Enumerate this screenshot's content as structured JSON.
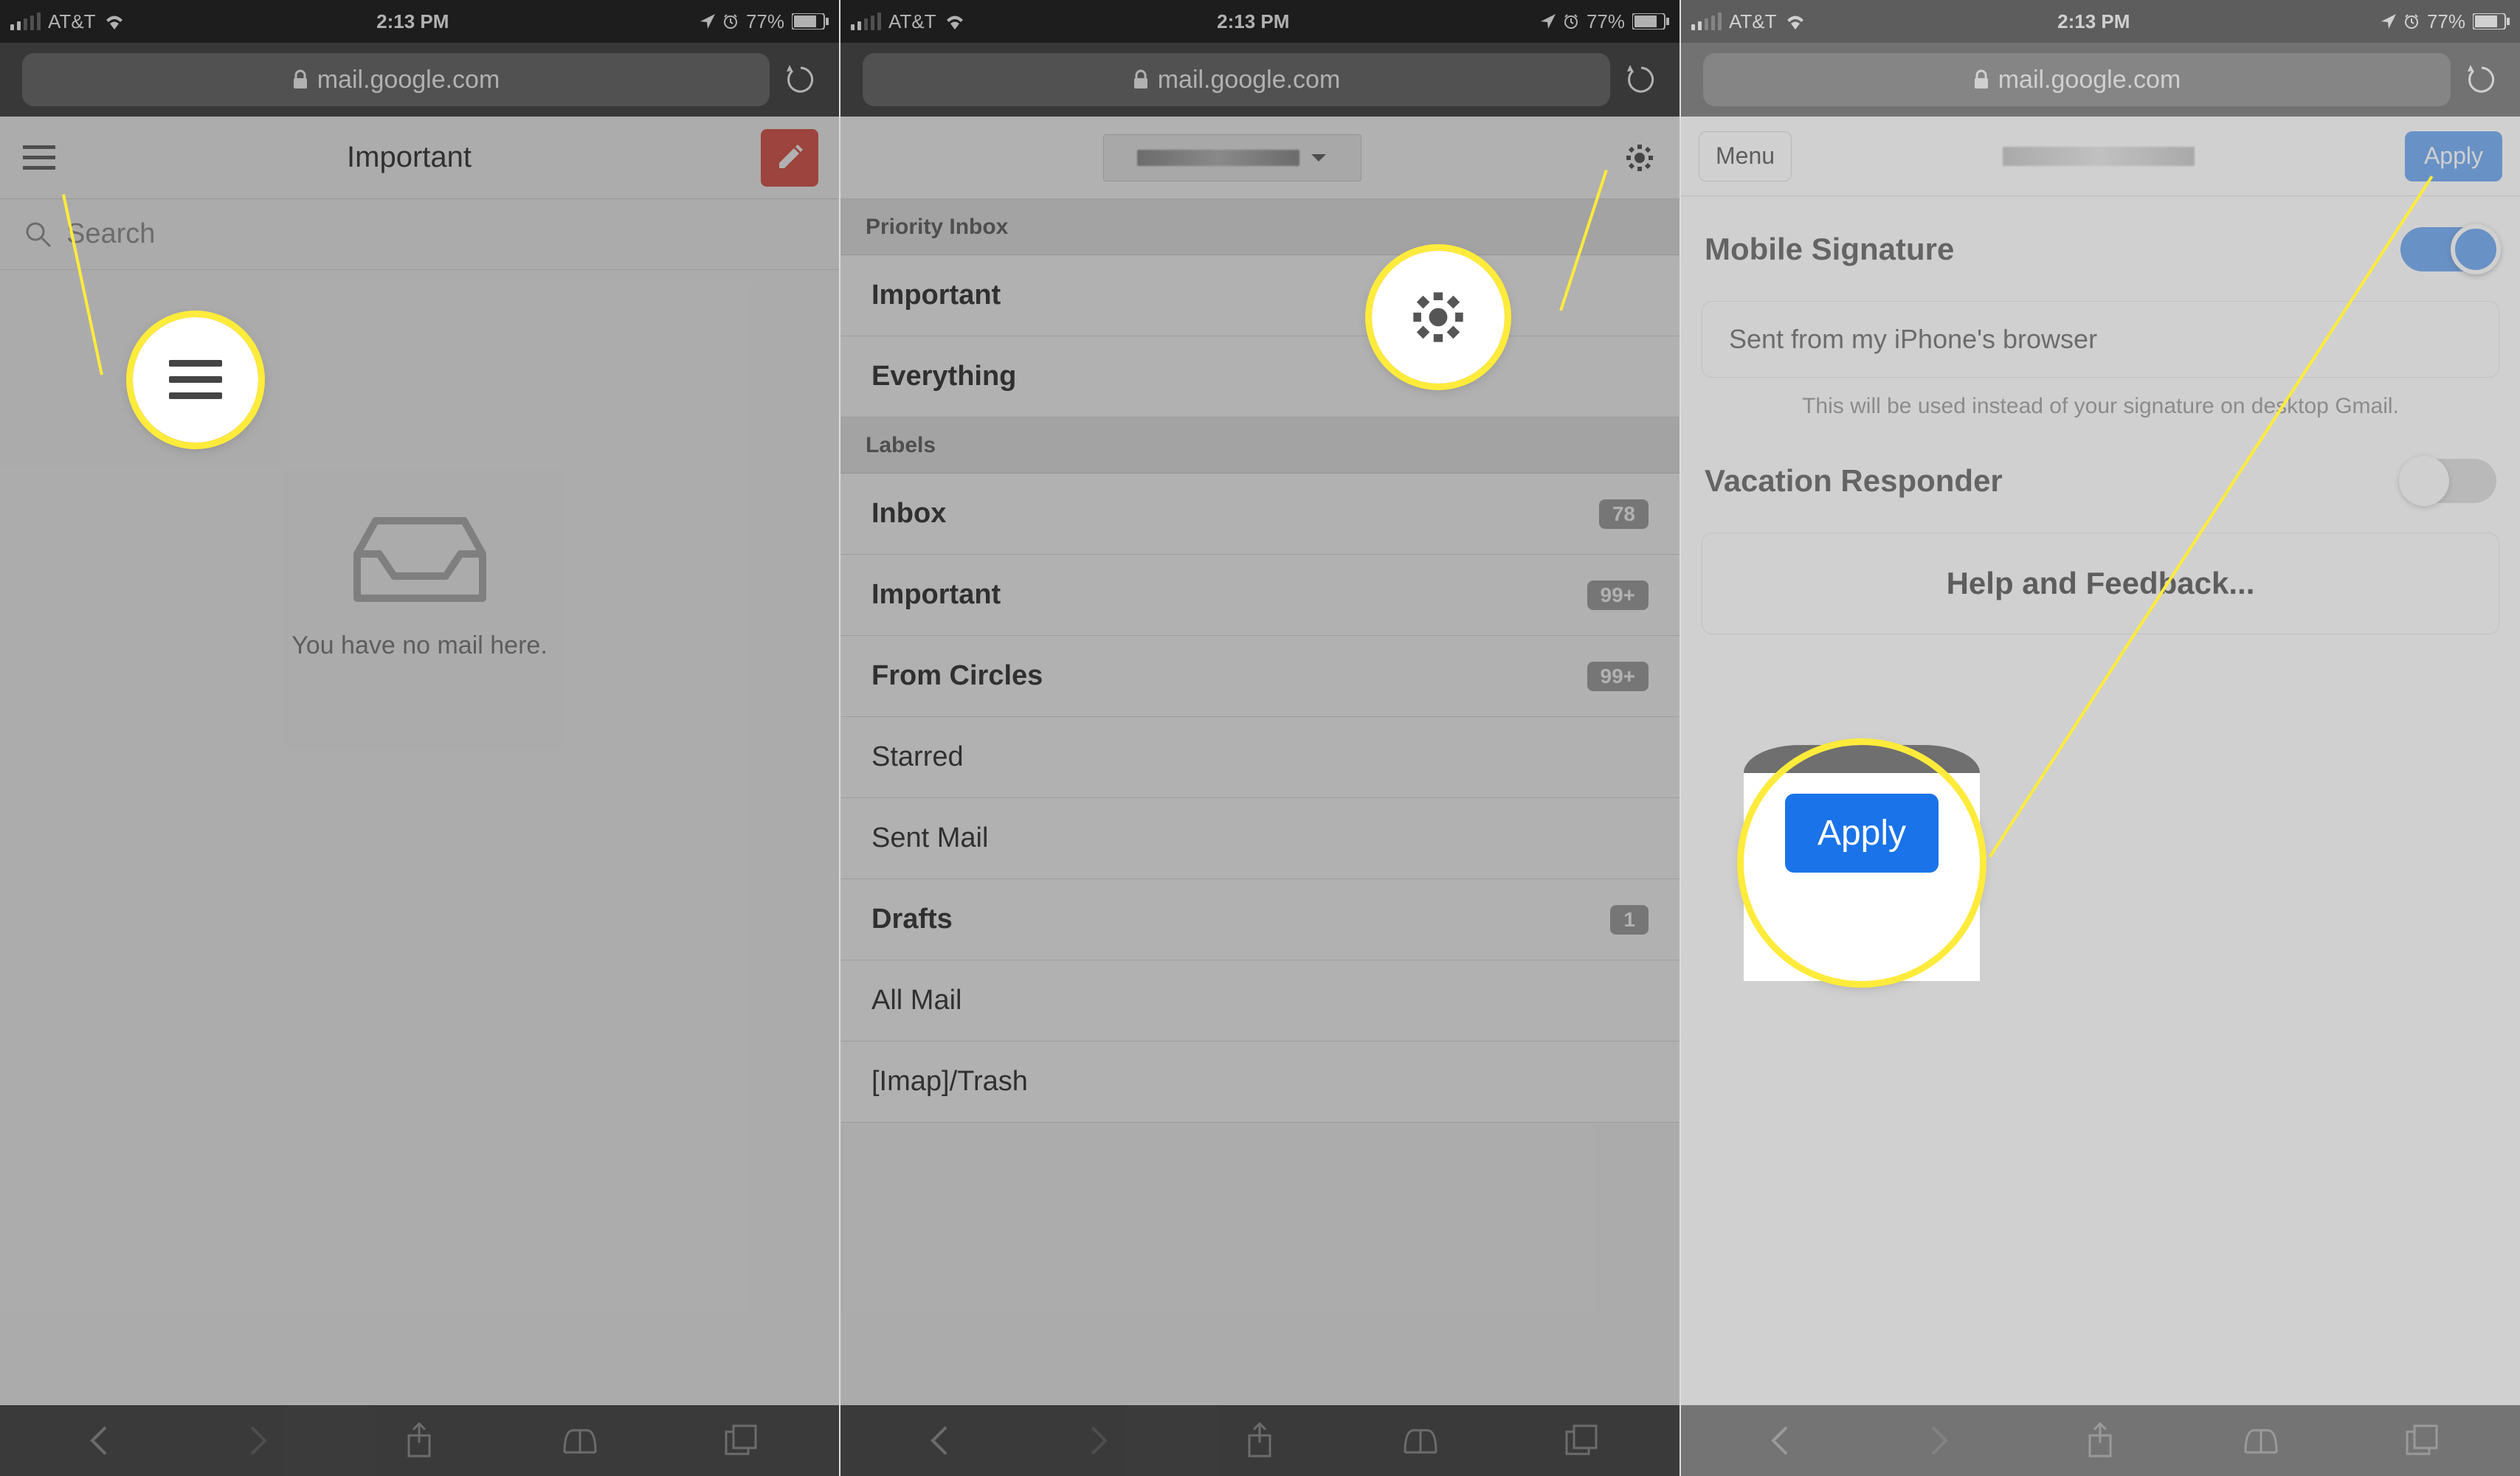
{
  "statusbar": {
    "carrier": "AT&T",
    "time": "2:13 PM",
    "battery": "77%"
  },
  "url": "mail.google.com",
  "screen1": {
    "page_title": "Important",
    "search_placeholder": "Search",
    "empty_message": "You have no mail here."
  },
  "screen2": {
    "sections": {
      "priority": "Priority Inbox",
      "labels": "Labels"
    },
    "priority_items": [
      {
        "label": "Important"
      },
      {
        "label": "Everything"
      }
    ],
    "label_items": [
      {
        "label": "Inbox",
        "badge": "78",
        "bold": true
      },
      {
        "label": "Important",
        "badge": "99+",
        "bold": true
      },
      {
        "label": "From Circles",
        "badge": "99+",
        "bold": true
      },
      {
        "label": "Starred",
        "bold": false
      },
      {
        "label": "Sent Mail",
        "bold": false
      },
      {
        "label": "Drafts",
        "badge": "1",
        "bold": true
      },
      {
        "label": "All Mail",
        "bold": false
      },
      {
        "label": "[Imap]/Trash",
        "bold": false
      }
    ]
  },
  "screen3": {
    "menu_label": "Menu",
    "apply_label": "Apply",
    "mobile_signature_label": "Mobile Signature",
    "signature_value": "Sent from my iPhone's browser",
    "signature_help": "This will be used instead of your signature on desktop Gmail.",
    "vacation_label": "Vacation Responder",
    "help_label": "Help and Feedback..."
  }
}
